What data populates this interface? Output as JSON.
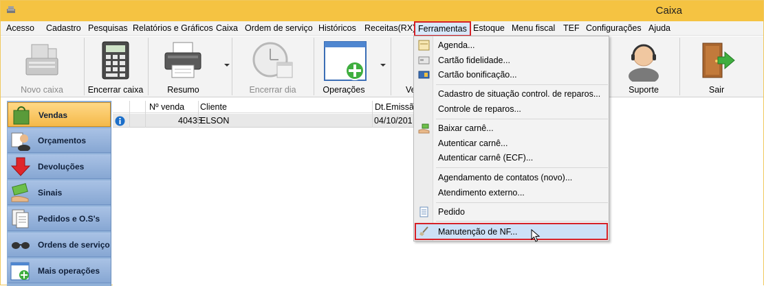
{
  "window": {
    "title": "Caixa"
  },
  "menubar": {
    "items": [
      "Acesso",
      "Cadastro",
      "Pesquisas",
      "Relatórios e Gráficos",
      "Caixa",
      "Ordem de serviço",
      "Históricos",
      "Receitas(RX)",
      "Ferramentas",
      "Estoque",
      "Menu fiscal",
      "TEF",
      "Configurações",
      "Ajuda"
    ],
    "active": "Ferramentas"
  },
  "toolbar": {
    "novo_caixa": "Novo caixa",
    "encerrar_caixa": "Encerrar caixa",
    "resumo": "Resumo",
    "encerrar_dia": "Encerrar dia",
    "operacoes": "Operações",
    "vendas_partial": "Ve",
    "suporte": "Suporte",
    "sair": "Sair"
  },
  "sidebar": {
    "items": [
      "Vendas",
      "Orçamentos",
      "Devoluções",
      "Sinais",
      "Pedidos e O.S's",
      "Ordens de serviço",
      "Mais operações"
    ],
    "active": "Vendas"
  },
  "grid": {
    "columns": [
      "Nº venda",
      "Cliente",
      "Dt.Emissã"
    ],
    "rows": [
      {
        "numero": "40435",
        "cliente": "ELSON",
        "data": "04/10/201"
      }
    ]
  },
  "ferramentas_menu": {
    "items": [
      "Agenda...",
      "Cartão fidelidade...",
      "Cartão bonificação...",
      "Cadastro de situação control. de reparos...",
      "Controle de reparos...",
      "Baixar carnê...",
      "Autenticar carnê...",
      "Autenticar carnê (ECF)...",
      "Agendamento de contatos (novo)...",
      "Atendimento externo...",
      "Pedido",
      "Manutenção de NF..."
    ],
    "highlighted": "Manutenção de NF..."
  },
  "colors": {
    "titlebar": "#f5c342",
    "highlight_border": "#d62027",
    "sidebar": "#8fb0d8",
    "sidebar_active": "#f4b94a"
  }
}
